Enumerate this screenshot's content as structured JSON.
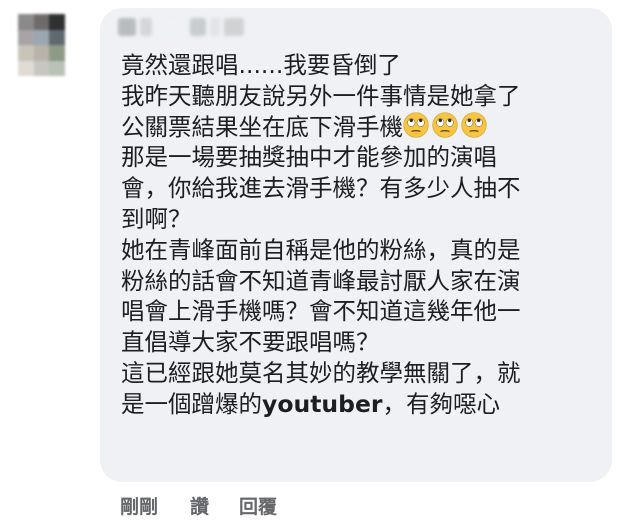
{
  "comment": {
    "lines": [
      "竟然還跟唱......我要昏倒了",
      "我昨天聽朋友說另外一件事情是她拿了",
      "公關票結果坐在底下滑手機",
      "那是一場要抽獎抽中才能參加的演唱",
      "會，你給我進去滑手機？有多少人抽不",
      "到啊？",
      "她在青峰面前自稱是他的粉絲，真的是",
      "粉絲的話會不知道青峰最討厭人家在演",
      "唱會上滑手機嗎？會不知道這幾年他一",
      "直倡導大家不要跟唱嗎？",
      "這已經跟她莫名其妙的教學無關了，就",
      "是一個蹭爆的"
    ],
    "youtuber_word": "youtuber",
    "last_line_tail": "，有夠噁心",
    "emojis": [
      "face-with-rolling-eyes",
      "face-with-rolling-eyes",
      "face-with-rolling-eyes"
    ]
  },
  "actions": {
    "timestamp": "剛剛",
    "like": "讚",
    "reply": "回覆"
  },
  "colors": {
    "bubble": "#eff1f4",
    "text": "#1c1e21",
    "meta": "#65676b"
  }
}
